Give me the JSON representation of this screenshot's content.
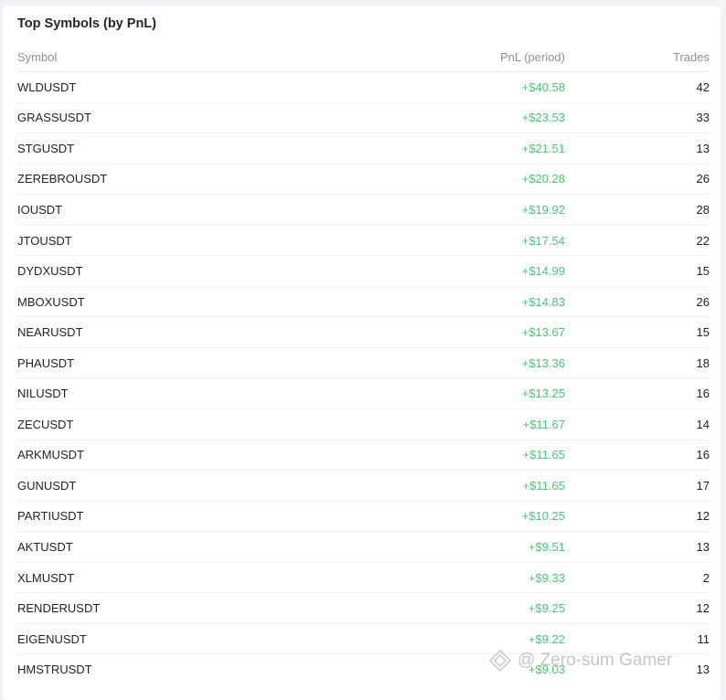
{
  "card": {
    "title": "Top Symbols (by PnL)"
  },
  "table": {
    "columns": {
      "symbol": "Symbol",
      "pnl": "PnL (period)",
      "trades": "Trades"
    },
    "rows": [
      {
        "symbol": "WLDUSDT",
        "pnl": "+$40.58",
        "trades": "42"
      },
      {
        "symbol": "GRASSUSDT",
        "pnl": "+$23.53",
        "trades": "33"
      },
      {
        "symbol": "STGUSDT",
        "pnl": "+$21.51",
        "trades": "13"
      },
      {
        "symbol": "ZEREBROUSDT",
        "pnl": "+$20.28",
        "trades": "26"
      },
      {
        "symbol": "IOUSDT",
        "pnl": "+$19.92",
        "trades": "28"
      },
      {
        "symbol": "JTOUSDT",
        "pnl": "+$17.54",
        "trades": "22"
      },
      {
        "symbol": "DYDXUSDT",
        "pnl": "+$14.99",
        "trades": "15"
      },
      {
        "symbol": "MBOXUSDT",
        "pnl": "+$14.83",
        "trades": "26"
      },
      {
        "symbol": "NEARUSDT",
        "pnl": "+$13.67",
        "trades": "15"
      },
      {
        "symbol": "PHAUSDT",
        "pnl": "+$13.36",
        "trades": "18"
      },
      {
        "symbol": "NILUSDT",
        "pnl": "+$13.25",
        "trades": "16"
      },
      {
        "symbol": "ZECUSDT",
        "pnl": "+$11.67",
        "trades": "14"
      },
      {
        "symbol": "ARKMUSDT",
        "pnl": "+$11.65",
        "trades": "16"
      },
      {
        "symbol": "GUNUSDT",
        "pnl": "+$11.65",
        "trades": "17"
      },
      {
        "symbol": "PARTIUSDT",
        "pnl": "+$10.25",
        "trades": "12"
      },
      {
        "symbol": "AKTUSDT",
        "pnl": "+$9.51",
        "trades": "13"
      },
      {
        "symbol": "XLMUSDT",
        "pnl": "+$9.33",
        "trades": "2"
      },
      {
        "symbol": "RENDERUSDT",
        "pnl": "+$9.25",
        "trades": "12"
      },
      {
        "symbol": "EIGENUSDT",
        "pnl": "+$9.22",
        "trades": "11"
      },
      {
        "symbol": "HMSTRUSDT",
        "pnl": "+$9.03",
        "trades": "13"
      }
    ]
  },
  "watermark": {
    "icon": "diamond-logo-icon",
    "text": "@ Zero-sum Gamer"
  },
  "colors": {
    "positive": "#4fc378",
    "text": "#20232f",
    "muted": "#8a909c"
  }
}
